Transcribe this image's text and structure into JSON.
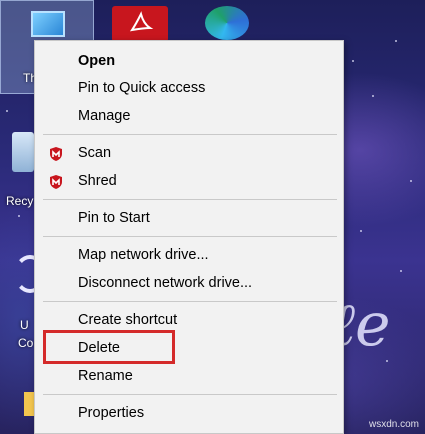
{
  "desktop": {
    "icons": {
      "this_pc_label": "Th",
      "recycle_label": "Recy",
      "vpn_label_line1": "U",
      "vpn_label_line2": "Co"
    },
    "watermark": "wsxdn.com"
  },
  "context_menu": {
    "groups": [
      [
        {
          "label": "Open",
          "bold": true
        },
        {
          "label": "Pin to Quick access"
        },
        {
          "label": "Manage"
        }
      ],
      [
        {
          "label": "Scan",
          "icon": "mcafee-shield-icon"
        },
        {
          "label": "Shred",
          "icon": "mcafee-shield-icon"
        }
      ],
      [
        {
          "label": "Pin to Start"
        }
      ],
      [
        {
          "label": "Map network drive..."
        },
        {
          "label": "Disconnect network drive..."
        }
      ],
      [
        {
          "label": "Create shortcut"
        },
        {
          "label": "Delete",
          "highlighted": true
        },
        {
          "label": "Rename"
        }
      ],
      [
        {
          "label": "Properties"
        }
      ]
    ],
    "highlight_color": "#d42a2a",
    "icon_color": "#c8161e"
  }
}
